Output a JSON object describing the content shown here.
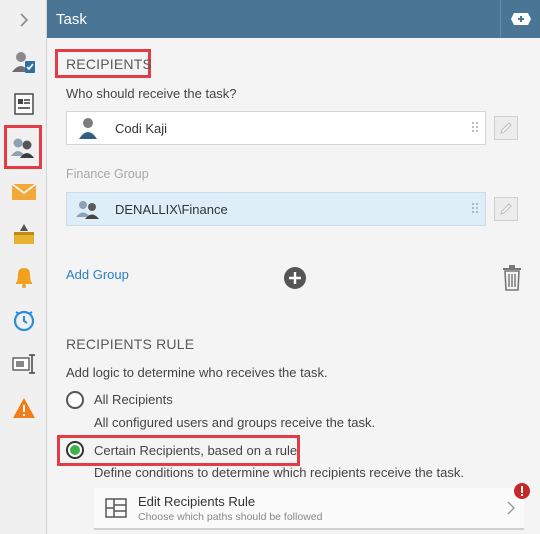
{
  "header": {
    "title": "Task"
  },
  "recipients": {
    "title": "RECIPIENTS",
    "prompt": "Who should receive the task?",
    "user": "Codi Kaji",
    "group_label": "Finance Group",
    "group_value": "DENALLIX\\Finance",
    "add_group": "Add Group"
  },
  "rule": {
    "title": "RECIPIENTS RULE",
    "prompt": "Add logic to determine who receives the task.",
    "opt_all": "All Recipients",
    "opt_all_desc": "All configured users and groups receive the task.",
    "opt_certain": "Certain Recipients, based on a rule",
    "opt_certain_desc": "Define conditions to determine which recipients receive the task.",
    "edit_title": "Edit Recipients Rule",
    "edit_sub": "Choose which paths should be followed",
    "selected": "certain"
  },
  "colors": {
    "accent": "#e23c44",
    "header": "#4b7595",
    "link": "#2a7fc9",
    "radio_on": "#3cb34a"
  },
  "rail_icons": [
    "expand-chevron-icon",
    "task-user-icon",
    "form-icon",
    "recipients-icon",
    "email-icon",
    "package-icon",
    "alert-bell-icon",
    "timer-icon",
    "resize-text-icon",
    "warning-icon"
  ]
}
